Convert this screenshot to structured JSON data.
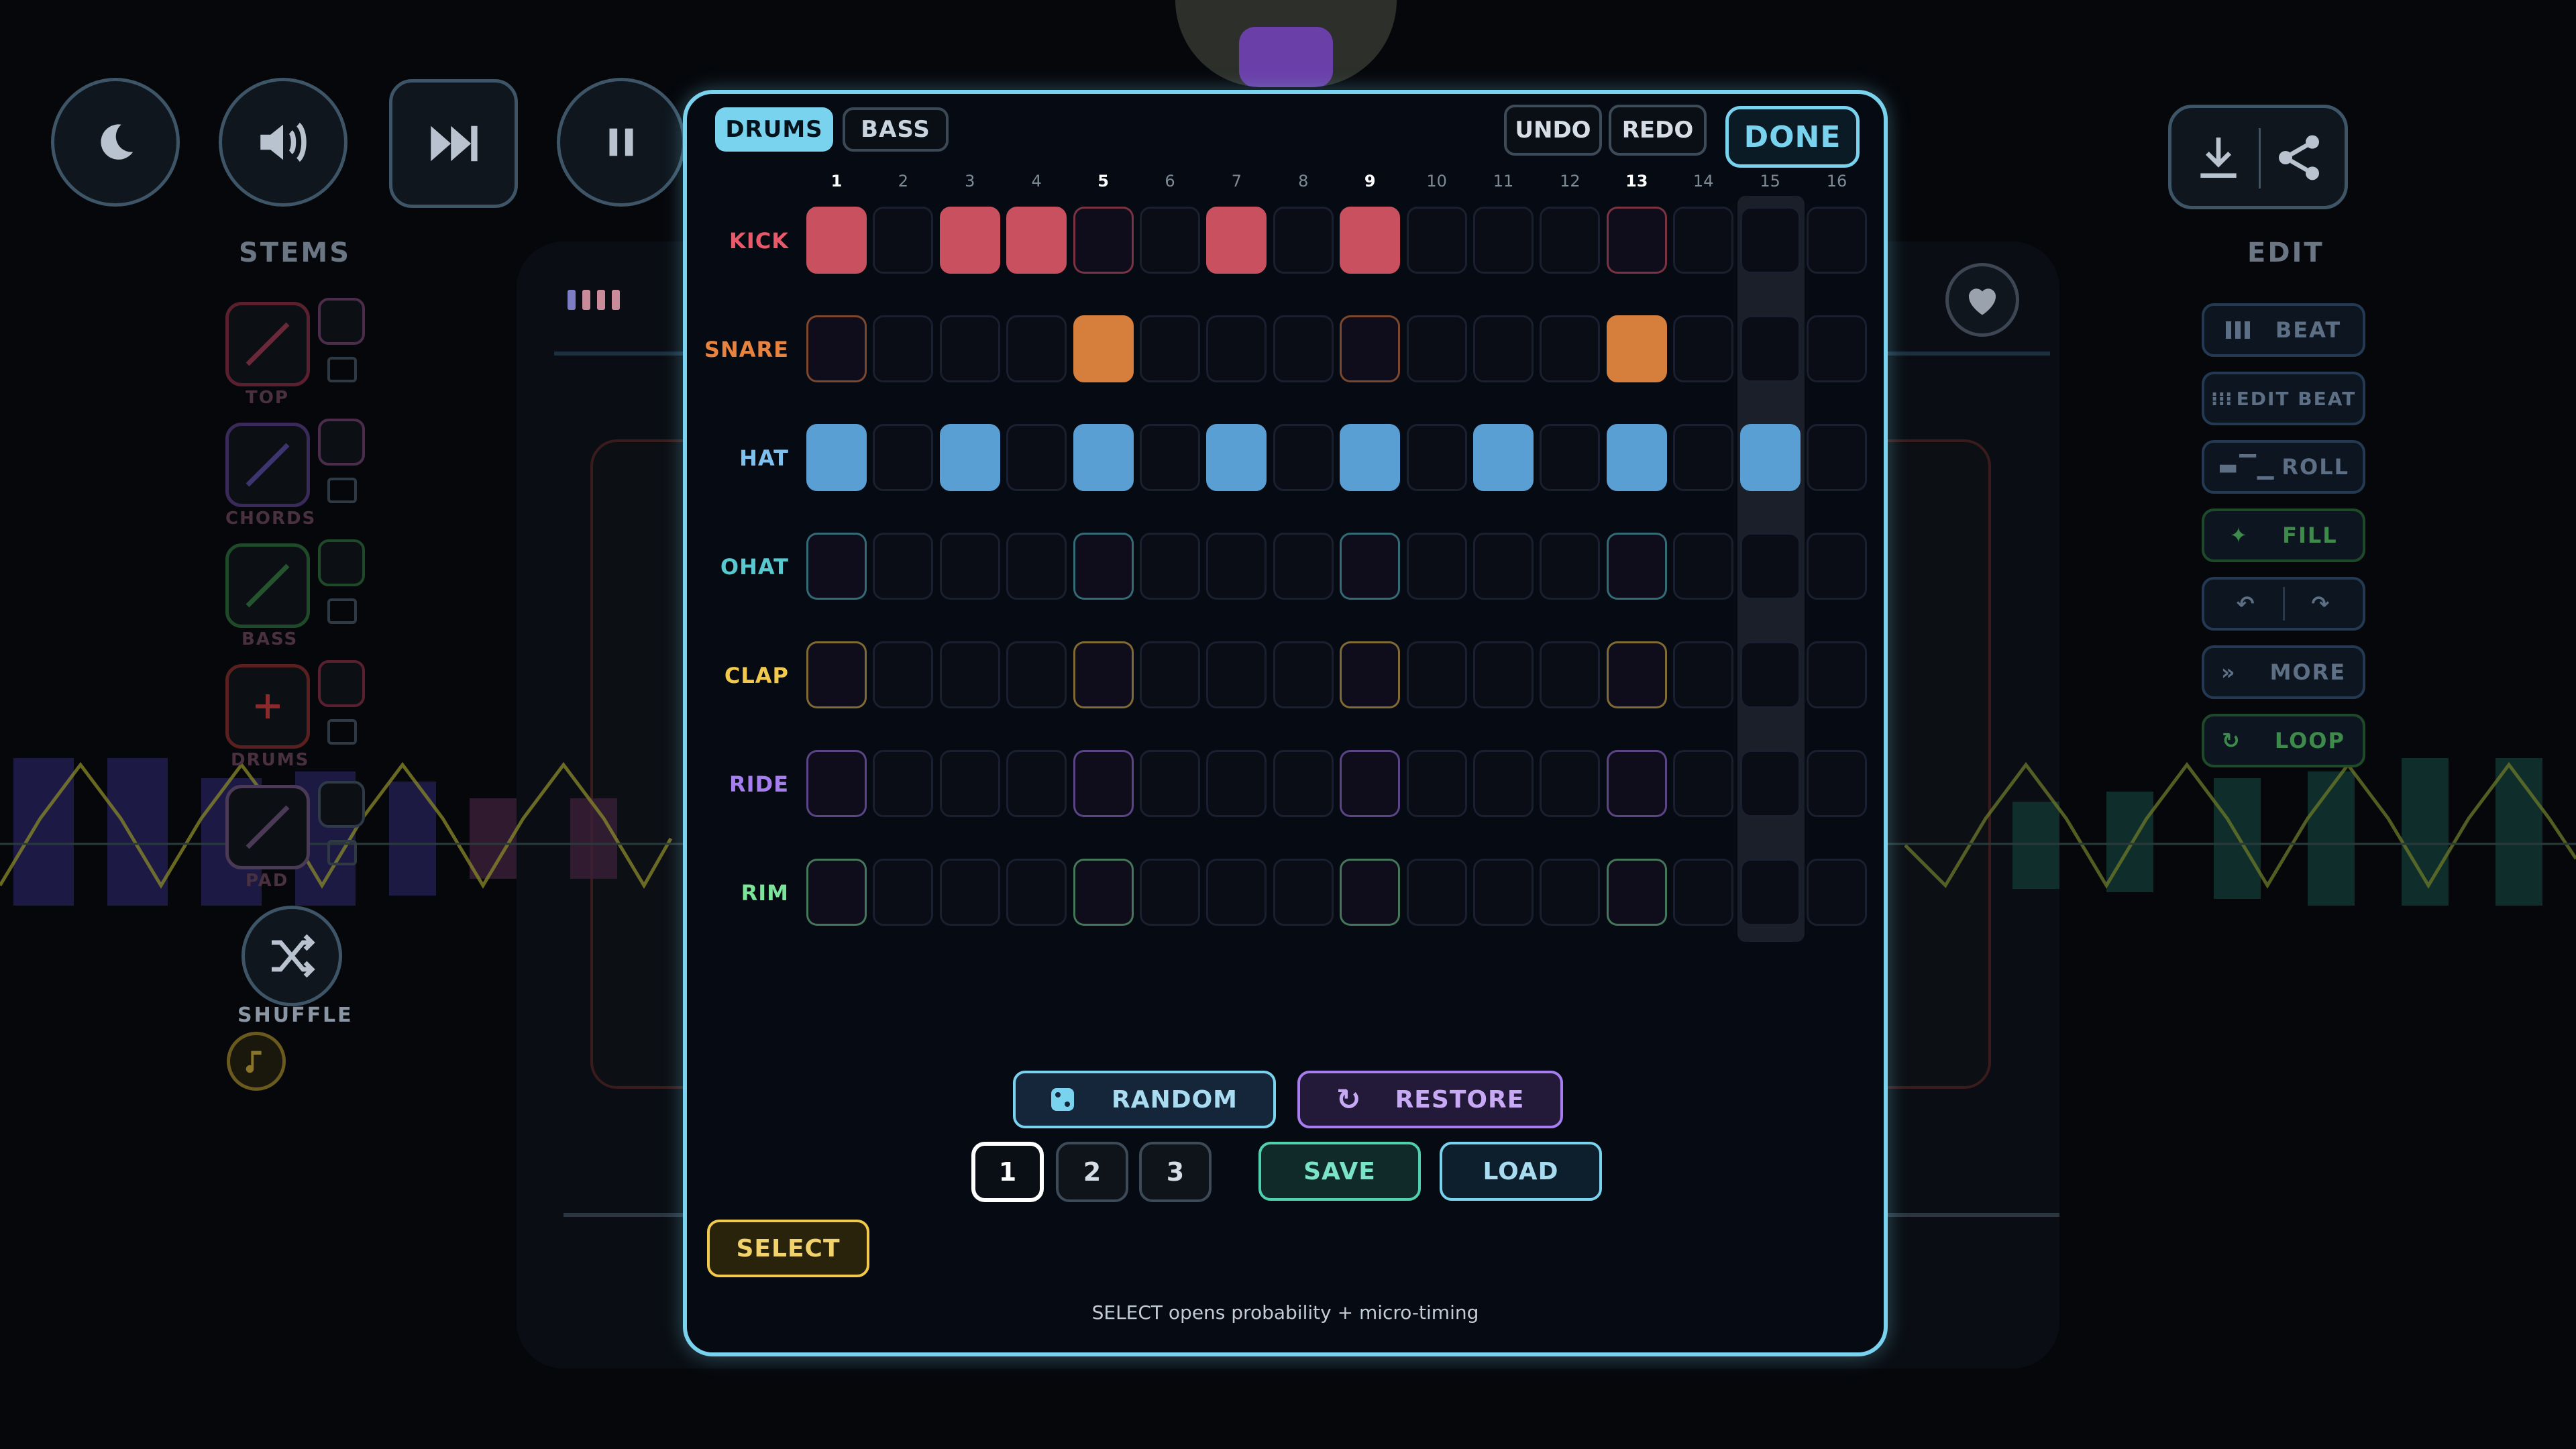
{
  "background": {
    "stems_title": "STEMS",
    "edit_title": "EDIT",
    "stems": [
      {
        "label": "TOP",
        "color": "#5a2030"
      },
      {
        "label": "CHORDS",
        "color": "#3a2a5a"
      },
      {
        "label": "BASS",
        "color": "#1f4a2a"
      },
      {
        "label": "DRUMS",
        "color": "#5a2020"
      },
      {
        "label": "PAD",
        "color": "#4a3a55"
      }
    ],
    "shuffle_label": "SHUFFLE",
    "edit_buttons": [
      {
        "label": "BEAT",
        "color": "#5d6f84"
      },
      {
        "label": "EDIT BEAT",
        "color": "#5d6f84"
      },
      {
        "label": "ROLL",
        "color": "#5d6f84"
      },
      {
        "label": "FILL",
        "color": "#3e8a4a"
      },
      {
        "label": "",
        "color": "#5d6f84"
      },
      {
        "label": "MORE",
        "color": "#5d6f84"
      },
      {
        "label": "LOOP",
        "color": "#3e8a4a"
      }
    ]
  },
  "modal": {
    "tabs": [
      {
        "label": "DRUMS",
        "active": true
      },
      {
        "label": "BASS",
        "active": false
      }
    ],
    "undo_label": "UNDO",
    "redo_label": "REDO",
    "done_label": "DONE",
    "steps": [
      "1",
      "2",
      "3",
      "4",
      "5",
      "6",
      "7",
      "8",
      "9",
      "10",
      "11",
      "12",
      "13",
      "14",
      "15",
      "16"
    ],
    "accent_steps": [
      1,
      5,
      9,
      13
    ],
    "current_step": 15,
    "tracks": [
      {
        "name": "KICK",
        "label_color": "#e8596a",
        "on_color": "#c9505e",
        "border_color": "#4a2233",
        "steps": [
          1,
          0,
          1,
          1,
          0,
          0,
          1,
          0,
          1,
          0,
          0,
          0,
          0,
          0,
          0,
          0
        ]
      },
      {
        "name": "SNARE",
        "label_color": "#e8833f",
        "on_color": "#d67f3c",
        "border_color": "#4d2e22",
        "steps": [
          0,
          0,
          0,
          0,
          1,
          0,
          0,
          0,
          0,
          0,
          0,
          0,
          1,
          0,
          0,
          0
        ]
      },
      {
        "name": "HAT",
        "label_color": "#7fc1ee",
        "on_color": "#5a9fd3",
        "border_color": "#1d2d44",
        "steps": [
          1,
          0,
          1,
          0,
          1,
          0,
          1,
          0,
          1,
          0,
          1,
          0,
          1,
          0,
          1,
          0
        ]
      },
      {
        "name": "OHAT",
        "label_color": "#58c9cf",
        "on_color": "#3fa8ae",
        "border_color": "#193a40",
        "steps": [
          0,
          0,
          0,
          0,
          0,
          0,
          0,
          0,
          0,
          0,
          0,
          0,
          0,
          0,
          0,
          0
        ]
      },
      {
        "name": "CLAP",
        "label_color": "#f2c94c",
        "on_color": "#d2ad3c",
        "border_color": "#3c3418",
        "steps": [
          0,
          0,
          0,
          0,
          0,
          0,
          0,
          0,
          0,
          0,
          0,
          0,
          0,
          0,
          0,
          0
        ]
      },
      {
        "name": "RIDE",
        "label_color": "#a77ef0",
        "on_color": "#8b65d2",
        "border_color": "#2d2144",
        "steps": [
          0,
          0,
          0,
          0,
          0,
          0,
          0,
          0,
          0,
          0,
          0,
          0,
          0,
          0,
          0,
          0
        ]
      },
      {
        "name": "RIM",
        "label_color": "#7be39a",
        "on_color": "#5fc27e",
        "border_color": "#263a3a",
        "steps": [
          0,
          0,
          0,
          0,
          0,
          0,
          0,
          0,
          0,
          0,
          0,
          0,
          0,
          0,
          0,
          0
        ]
      }
    ],
    "random_label": "RANDOM",
    "restore_label": "RESTORE",
    "slots": [
      {
        "label": "1",
        "selected": true
      },
      {
        "label": "2",
        "selected": false
      },
      {
        "label": "3",
        "selected": false
      }
    ],
    "save_label": "SAVE",
    "load_label": "LOAD",
    "select_label": "SELECT",
    "hint_text": "SELECT opens probability + micro-timing"
  }
}
